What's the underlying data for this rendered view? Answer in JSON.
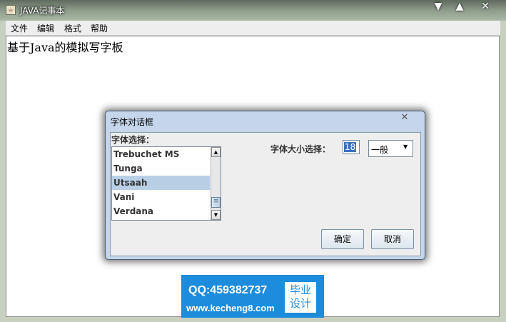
{
  "window": {
    "title": "JAVA记事本",
    "icon": "java-cup-icon",
    "controls": {
      "minimize": "▼",
      "maximize": "▲",
      "close": "✕"
    }
  },
  "menubar": {
    "items": [
      "文件",
      "编辑",
      "格式",
      "帮助"
    ]
  },
  "editor": {
    "text": "基于Java的模拟写字板"
  },
  "font_dialog": {
    "title": "字体对话框",
    "close_glyph": "✕",
    "font_label": "字体选择：",
    "fonts": [
      "Trebuchet MS",
      "Tunga",
      "Utsaah",
      "Vani",
      "Verdana"
    ],
    "selected_font": "Utsaah",
    "size_label": "字体大小选择：",
    "size_value": "18",
    "style_value": "一般",
    "ok_label": "确定",
    "cancel_label": "取消"
  },
  "watermark": {
    "qq": "QQ:459382737",
    "site": "www.kecheng8.com",
    "badge_line1": "毕业",
    "badge_line2": "设计"
  }
}
